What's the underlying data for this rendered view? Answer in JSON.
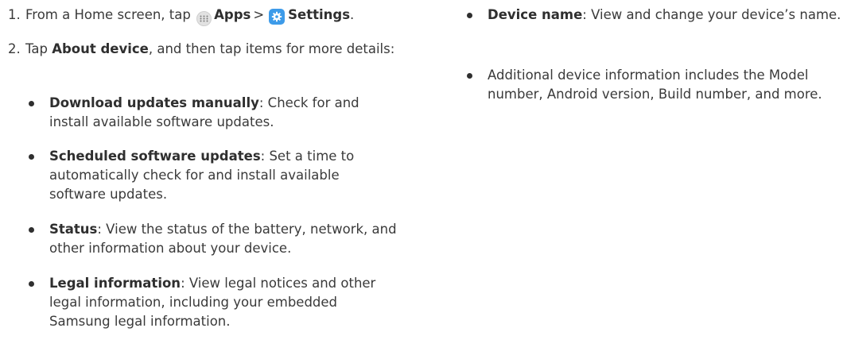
{
  "steps": [
    {
      "num": "1.",
      "pre": "From a Home screen, tap",
      "apps_icon": "apps-grid-icon",
      "apps_label": "Apps",
      "separator": ">",
      "settings_icon": "settings-gear-icon",
      "settings_label": "Settings",
      "post": "."
    },
    {
      "num": "2.",
      "pre": "Tap",
      "bold": "About device",
      "post": ", and then tap items for more details:"
    }
  ],
  "left_bullets": [
    {
      "term": "Download updates manually",
      "desc": ": Check for and install available software updates."
    },
    {
      "term": "Scheduled software updates",
      "desc": ": Set a time to automatically check for and install available software updates."
    },
    {
      "term": "Status",
      "desc": ": View the status of the battery, network, and other information about your device."
    },
    {
      "term": "Legal information",
      "desc": ": View legal notices and other legal information, including your embedded Samsung legal information."
    }
  ],
  "right_bullets": [
    {
      "term": "Device name",
      "desc": ": View and change your device’s name."
    },
    {
      "term": "",
      "desc": "Additional device information includes the Model number, Android version, Build number, and more."
    }
  ],
  "colors": {
    "text": "#3a3a3a",
    "settings_icon_bg": "#3d9be9",
    "apps_icon_bg": "#e2e2e2"
  }
}
